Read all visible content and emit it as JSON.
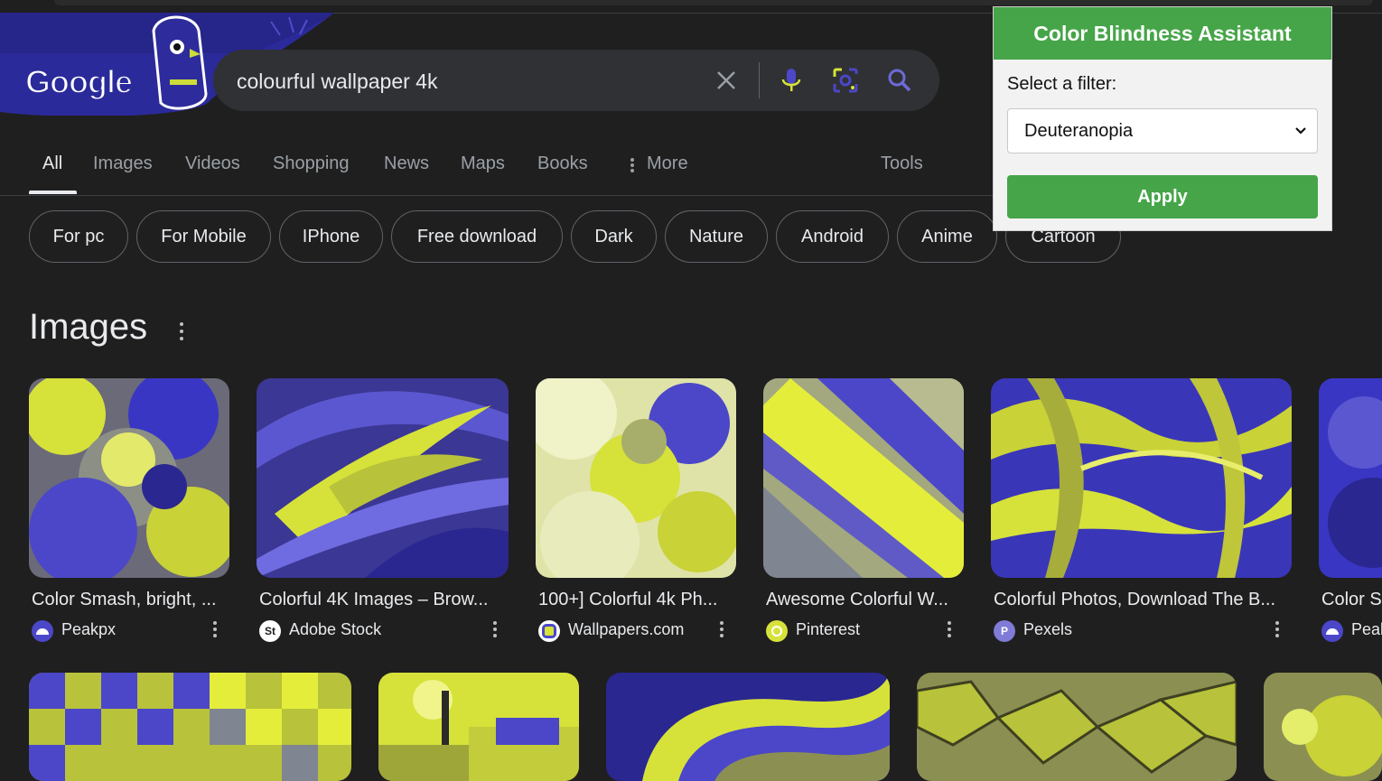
{
  "search": {
    "query": "colourful wallpaper 4k",
    "logo_text": "Google"
  },
  "tabs": [
    {
      "label": "All"
    },
    {
      "label": "Images"
    },
    {
      "label": "Videos"
    },
    {
      "label": "Shopping"
    },
    {
      "label": "News"
    },
    {
      "label": "Maps"
    },
    {
      "label": "Books"
    },
    {
      "label": "More"
    },
    {
      "label": "Tools"
    }
  ],
  "chips": [
    {
      "label": "For pc"
    },
    {
      "label": "For Mobile"
    },
    {
      "label": "IPhone"
    },
    {
      "label": "Free download"
    },
    {
      "label": "Dark"
    },
    {
      "label": "Nature"
    },
    {
      "label": "Android"
    },
    {
      "label": "Anime"
    },
    {
      "label": "Cartoon"
    }
  ],
  "images_section": {
    "title": "Images",
    "results": [
      {
        "title": "Color Smash, bright, ...",
        "source": "Peakpx"
      },
      {
        "title": "Colorful 4K Images – Brow...",
        "source": "Adobe Stock",
        "favicon_text": "St"
      },
      {
        "title": "100+] Colorful 4k Ph...",
        "source": "Wallpapers.com"
      },
      {
        "title": "Awesome Colorful W...",
        "source": "Pinterest"
      },
      {
        "title": "Colorful Photos, Download The B...",
        "source": "Pexels",
        "favicon_text": "P"
      },
      {
        "title": "Color S",
        "source": "Peak"
      }
    ]
  },
  "extension_popup": {
    "title": "Color Blindness Assistant",
    "select_label": "Select a filter:",
    "selected_filter": "Deuteranopia",
    "apply_label": "Apply",
    "accent_color": "#46a549"
  },
  "colors": {
    "background": "#1f1f1f",
    "search_box": "#303134",
    "filter_yellow": "#d6e23a",
    "filter_blue": "#4b47c8"
  }
}
